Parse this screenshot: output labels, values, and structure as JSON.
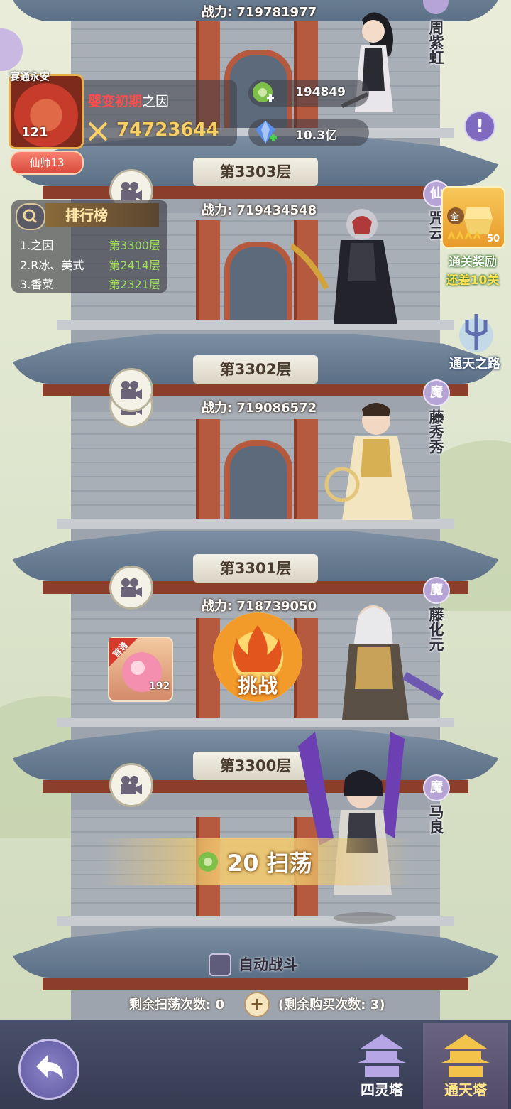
{
  "player": {
    "avatar_title": "宴通永安",
    "level": "121",
    "rank_badge": "仙师13",
    "realm": "婴变初期",
    "name": "之因",
    "battle_power": "74723644"
  },
  "resources": [
    {
      "icon": "jade-token-icon",
      "value": "194849"
    },
    {
      "icon": "blue-crystal-icon",
      "value": "10.3亿"
    }
  ],
  "leaderboard": {
    "title": "排行榜",
    "rows": [
      {
        "name": "1.之因",
        "floor": "第3300层"
      },
      {
        "name": "2.R冰、美式",
        "floor": "第2414层"
      },
      {
        "name": "3.香菜",
        "floor": "第2321层"
      }
    ]
  },
  "floors": [
    {
      "power_label": "战力: 719781977",
      "floor_label": "",
      "faction": "",
      "boss": "周紫虹"
    },
    {
      "power_label": "战力: 719434548",
      "floor_label": "第3303层",
      "faction": "仙",
      "boss": "咒云"
    },
    {
      "power_label": "战力: 719086572",
      "floor_label": "第3302层",
      "faction": "魔",
      "boss": "藤秀秀"
    },
    {
      "power_label": "战力: 718739050",
      "floor_label": "第3301层",
      "faction": "魔",
      "boss": "藤化元"
    },
    {
      "power_label": "",
      "floor_label": "第3300层",
      "faction": "魔",
      "boss": "马良"
    }
  ],
  "reward": {
    "badge": "全",
    "count": "50",
    "title": "通关奖励",
    "subtitle": "还差10关"
  },
  "tongtian_road": "通天之路",
  "challenge": {
    "label": "挑战"
  },
  "first_pass": {
    "tag": "首通",
    "quantity": "192"
  },
  "sweep": {
    "cost": "20",
    "label": "扫荡"
  },
  "auto_battle": {
    "label": "自动战斗",
    "checked": false
  },
  "remaining": {
    "sweeps_text": "剩余扫荡次数: 0",
    "buy_text": "(剩余购买次数: 3)"
  },
  "tabs": [
    {
      "label": "四灵塔",
      "selected": false
    },
    {
      "label": "通天塔",
      "selected": true
    }
  ],
  "colors": {
    "power_gold": "#f7d066",
    "realm_red": "#ff4d4d",
    "floor_green": "#9fe05a"
  }
}
